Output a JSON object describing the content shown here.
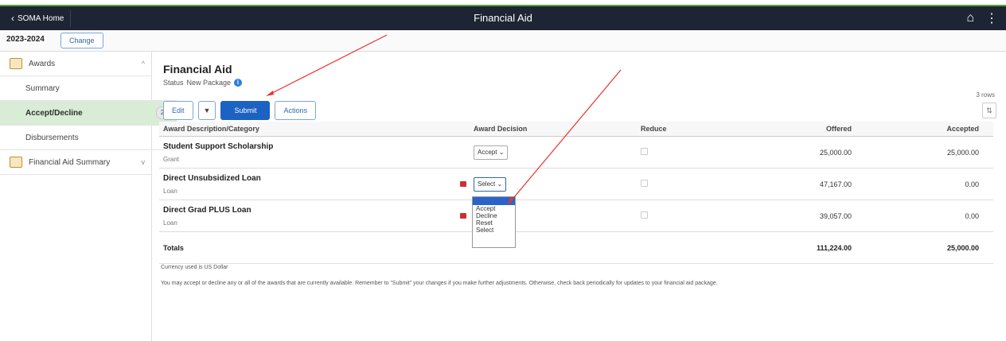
{
  "header": {
    "back_label": "SOMA Home",
    "title": "Financial Aid"
  },
  "aid_year": {
    "year": "2023-2024",
    "change_label": "Change"
  },
  "sidebar": {
    "items": [
      {
        "label": "Awards"
      },
      {
        "label": "Summary"
      },
      {
        "label": "Accept/Decline",
        "badge": "2"
      },
      {
        "label": "Disbursements"
      },
      {
        "label": "Financial Aid Summary"
      }
    ]
  },
  "main": {
    "title": "Financial Aid",
    "status_label": "Status",
    "status_value": "New Package",
    "rows_count": "3 rows",
    "toolbar": {
      "edit": "Edit",
      "submit": "Submit",
      "actions": "Actions"
    },
    "columns": [
      "Award Description/Category",
      "Award Decision",
      "Reduce",
      "Offered",
      "Accepted"
    ],
    "rows": [
      {
        "name": "Student Support Scholarship",
        "category": "Grant",
        "decision": "Accept",
        "offered": "25,000.00",
        "accepted": "25,000.00"
      },
      {
        "name": "Direct Unsubsidized Loan",
        "category": "Loan",
        "decision": "Select",
        "offered": "47,167.00",
        "accepted": "0.00"
      },
      {
        "name": "Direct Grad PLUS Loan",
        "category": "Loan",
        "decision": "",
        "offered": "39,057.00",
        "accepted": "0.00"
      }
    ],
    "totals": {
      "label": "Totals",
      "offered": "111,224.00",
      "accepted": "25,000.00"
    },
    "dropdown_options": [
      "Accept",
      "Decline",
      "Reset",
      "Select"
    ],
    "currency_note": "Currency used is US Dollar",
    "notice": "You may accept or decline any or all of the awards that are currently available. Remember to \"Submit\" your changes if you make further adjustments. Otherwise, check back periodically for updates to your financial aid package."
  },
  "colors": {
    "header_bg": "#1d2433",
    "primary": "#1b62c2",
    "active_nav": "#d8ecd6",
    "annotation_arrow": "#e8322e"
  }
}
